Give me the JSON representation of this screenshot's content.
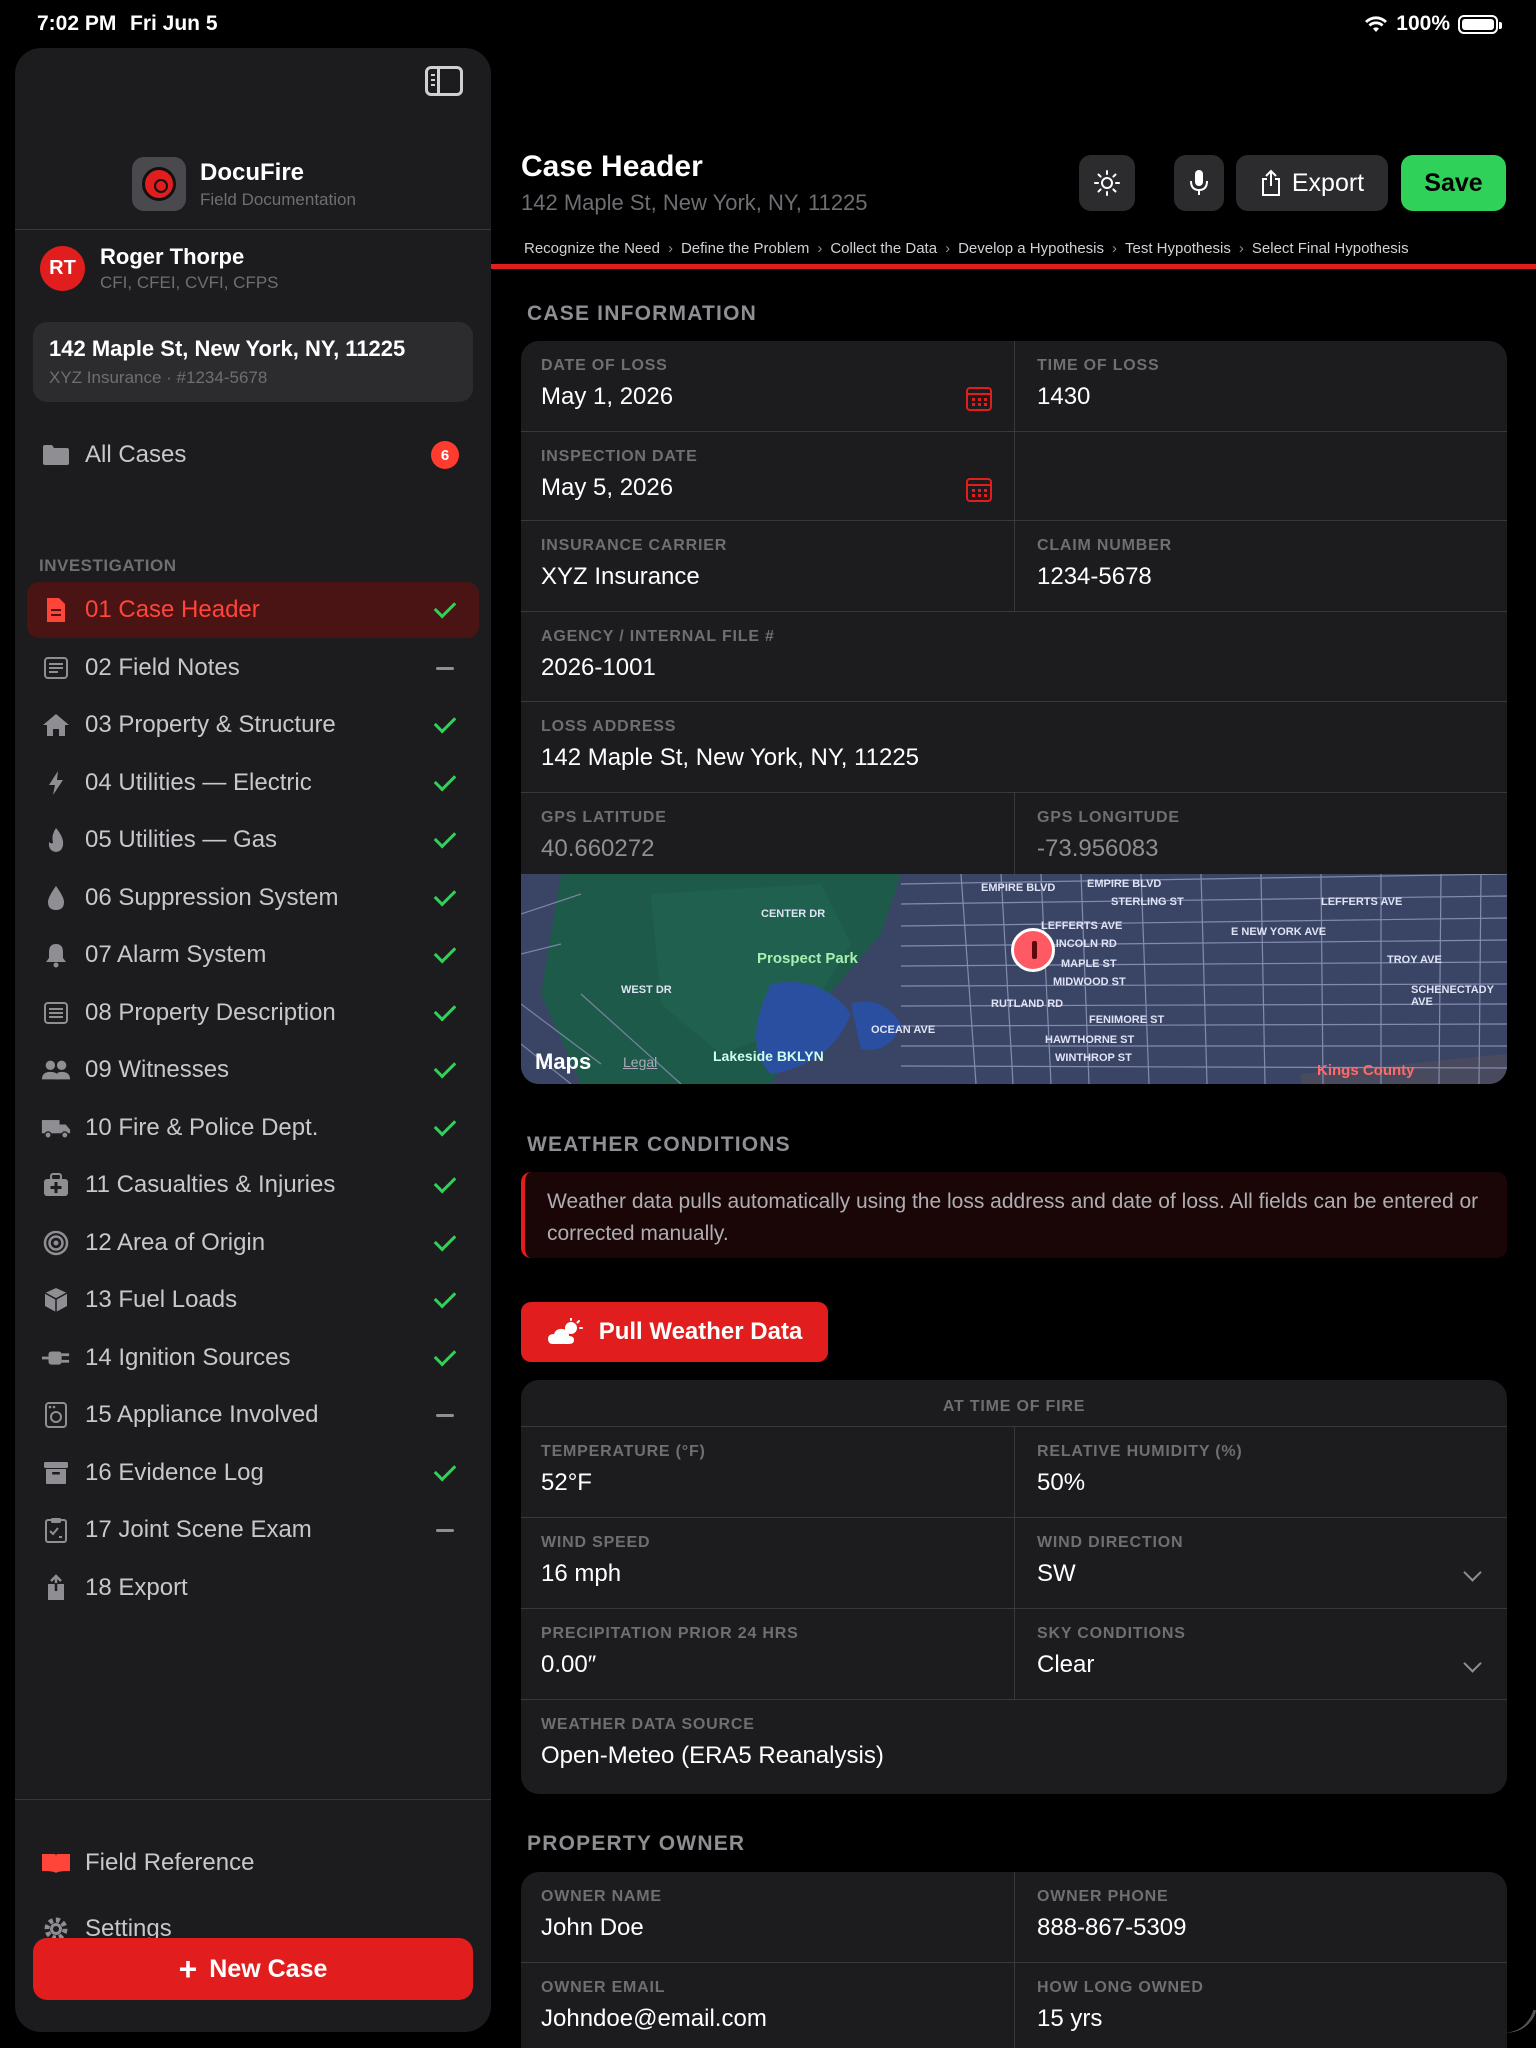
{
  "status_bar": {
    "time": "7:02 PM",
    "date": "Fri Jun 5",
    "battery": "100%"
  },
  "app": {
    "name": "DocuFire",
    "tagline": "Field Documentation"
  },
  "user": {
    "initials": "RT",
    "name": "Roger Thorpe",
    "credentials": "CFI, CFEI, CVFI, CFPS"
  },
  "current_case": {
    "address": "142 Maple St, New York, NY, 11225",
    "subtitle": "XYZ Insurance · #1234-5678"
  },
  "all_cases": {
    "label": "All Cases",
    "count": "6"
  },
  "section_label": "INVESTIGATION",
  "nav": [
    {
      "label": "01  Case Header",
      "icon": "document-icon",
      "status": "done",
      "active": true
    },
    {
      "label": "02  Field Notes",
      "icon": "notes-icon",
      "status": "pending"
    },
    {
      "label": "03  Property & Structure",
      "icon": "house-icon",
      "status": "done"
    },
    {
      "label": "04  Utilities — Electric",
      "icon": "bolt-icon",
      "status": "done"
    },
    {
      "label": "05  Utilities — Gas",
      "icon": "flame-icon",
      "status": "done"
    },
    {
      "label": "06  Suppression System",
      "icon": "drop-icon",
      "status": "done"
    },
    {
      "label": "07  Alarm System",
      "icon": "bell-icon",
      "status": "done"
    },
    {
      "label": "08  Property Description",
      "icon": "list-icon",
      "status": "done"
    },
    {
      "label": "09  Witnesses",
      "icon": "people-icon",
      "status": "done"
    },
    {
      "label": "10  Fire & Police Dept.",
      "icon": "truck-icon",
      "status": "done"
    },
    {
      "label": "11  Casualties & Injuries",
      "icon": "medkit-icon",
      "status": "done"
    },
    {
      "label": "12  Area of Origin",
      "icon": "target-icon",
      "status": "done"
    },
    {
      "label": "13  Fuel Loads",
      "icon": "cube-icon",
      "status": "done"
    },
    {
      "label": "14  Ignition Sources",
      "icon": "plug-icon",
      "status": "done"
    },
    {
      "label": "15  Appliance Involved",
      "icon": "appliance-icon",
      "status": "pending"
    },
    {
      "label": "16  Evidence Log",
      "icon": "archive-icon",
      "status": "done"
    },
    {
      "label": "17  Joint Scene Exam",
      "icon": "clipboard-icon",
      "status": "pending"
    },
    {
      "label": "18  Export",
      "icon": "share-icon",
      "status": "none"
    }
  ],
  "footer_nav": {
    "field_reference": "Field Reference",
    "settings": "Settings",
    "new_case": "New Case"
  },
  "header": {
    "title": "Case Header",
    "subtitle": "142 Maple St, New York, NY, 11225",
    "export_label": "Export",
    "save_label": "Save",
    "breadcrumb": [
      "Recognize the Need",
      "Define the Problem",
      "Collect the Data",
      "Develop a Hypothesis",
      "Test Hypothesis",
      "Select Final Hypothesis"
    ]
  },
  "case_info": {
    "title": "CASE INFORMATION",
    "date_of_loss": {
      "label": "DATE OF LOSS",
      "value": "May 1, 2026"
    },
    "time_of_loss": {
      "label": "TIME OF LOSS",
      "value": "1430"
    },
    "inspection_date": {
      "label": "INSPECTION DATE",
      "value": "May 5, 2026"
    },
    "insurance_carrier": {
      "label": "INSURANCE CARRIER",
      "value": "XYZ Insurance"
    },
    "claim_number": {
      "label": "CLAIM NUMBER",
      "value": "1234-5678"
    },
    "agency_file": {
      "label": "AGENCY / INTERNAL FILE #",
      "value": "2026-1001"
    },
    "loss_address": {
      "label": "LOSS ADDRESS",
      "value": "142 Maple St, New York, NY, 11225"
    },
    "gps_lat": {
      "label": "GPS LATITUDE",
      "value": "40.660272"
    },
    "gps_lon": {
      "label": "GPS LONGITUDE",
      "value": "-73.956083"
    }
  },
  "map": {
    "maps_label": "Maps",
    "legal": "Legal",
    "labels": {
      "prospect_park": "Prospect Park",
      "lakeside": "Lakeside BKLYN",
      "kings_county": "Kings County",
      "empire_blvd": "EMPIRE BLVD",
      "empire_blvd_2": "EMPIRE BLVD",
      "sterling_st": "STERLING ST",
      "lefferts_ave": "LEFFERTS AVE",
      "lefferts_ave_2": "LEFFERTS AVE",
      "lincoln_rd": "LINCOLN RD",
      "maple_st": "MAPLE ST",
      "midwood_st": "MIDWOOD ST",
      "rutland_rd": "RUTLAND RD",
      "fenimore_st": "FENIMORE ST",
      "hawthorne_st": "HAWTHORNE ST",
      "winthrop_st": "WINTHROP ST",
      "e_new_york_ave": "E NEW YORK AVE",
      "center_dr": "CENTER DR",
      "west_dr": "WEST DR",
      "ocean_ave": "OCEAN AVE",
      "troy_ave": "TROY AVE",
      "schenectady_ave": "SCHENECTADY AVE"
    }
  },
  "weather": {
    "title": "WEATHER CONDITIONS",
    "info": "Weather data pulls automatically using the loss address and date of loss. All fields can be entered or corrected manually.",
    "pull_label": "Pull Weather Data",
    "card_title": "AT TIME OF FIRE",
    "temperature": {
      "label": "TEMPERATURE (°F)",
      "value": "52°F"
    },
    "humidity": {
      "label": "RELATIVE HUMIDITY (%)",
      "value": "50%"
    },
    "wind_speed": {
      "label": "WIND SPEED",
      "value": "16 mph"
    },
    "wind_direction": {
      "label": "WIND DIRECTION",
      "value": "SW"
    },
    "precip": {
      "label": "PRECIPITATION PRIOR 24 HRS",
      "value": "0.00″"
    },
    "sky": {
      "label": "SKY CONDITIONS",
      "value": "Clear"
    },
    "source": {
      "label": "WEATHER DATA SOURCE",
      "value": "Open-Meteo (ERA5 Reanalysis)"
    }
  },
  "owner": {
    "title": "PROPERTY OWNER",
    "name": {
      "label": "OWNER NAME",
      "value": "John Doe"
    },
    "phone": {
      "label": "OWNER PHONE",
      "value": "888-867-5309"
    },
    "email": {
      "label": "OWNER EMAIL",
      "value": "Johndoe@email.com"
    },
    "owned": {
      "label": "HOW LONG OWNED",
      "value": "15 yrs"
    }
  },
  "colors": {
    "accent": "#e21d1d",
    "success": "#30d158",
    "background": "#000000",
    "surface": "#1c1c1e"
  }
}
